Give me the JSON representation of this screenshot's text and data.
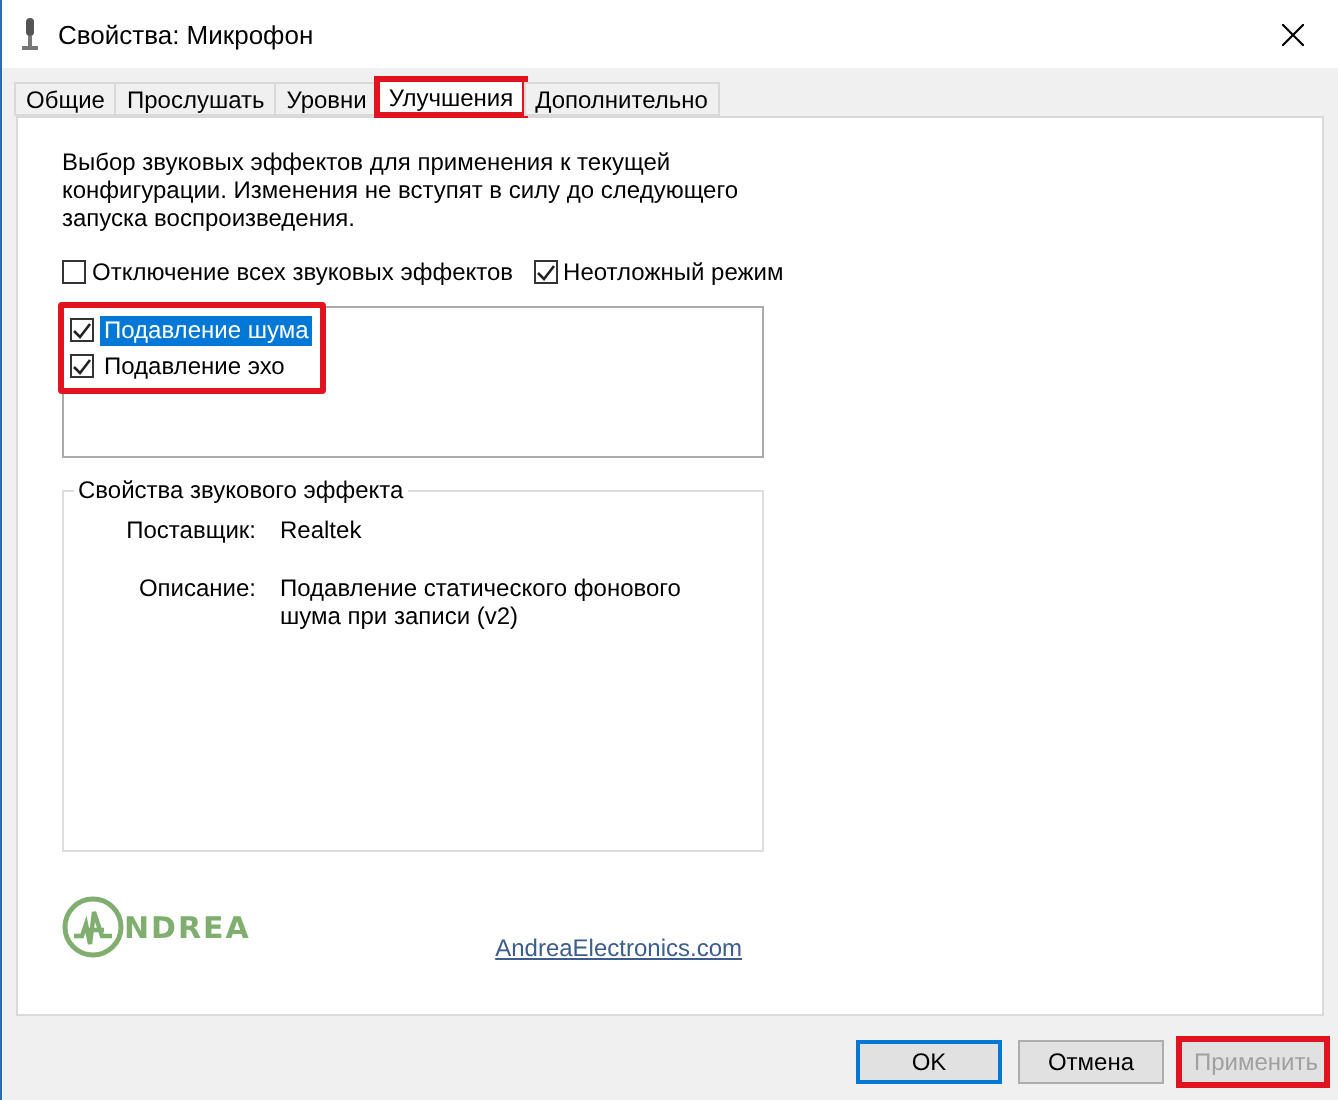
{
  "window": {
    "title": "Свойства: Микрофон"
  },
  "tabs": [
    {
      "label": "Общие",
      "selected": false,
      "highlighted": false
    },
    {
      "label": "Прослушать",
      "selected": false,
      "highlighted": false
    },
    {
      "label": "Уровни",
      "selected": false,
      "highlighted": false
    },
    {
      "label": "Улучшения",
      "selected": true,
      "highlighted": true
    },
    {
      "label": "Дополнительно",
      "selected": false,
      "highlighted": false
    }
  ],
  "description": "Выбор звуковых эффектов для применения к текущей конфигурации. Изменения не вступят в силу до следующего запуска воспроизведения.",
  "options": [
    {
      "label": "Отключение всех звуковых эффектов",
      "checked": false
    },
    {
      "label": "Неотложный режим",
      "checked": true
    }
  ],
  "effects": {
    "highlighted": true,
    "items": [
      {
        "label": "Подавление шума",
        "checked": true,
        "selected": true
      },
      {
        "label": "Подавление эхо",
        "checked": true,
        "selected": false
      }
    ]
  },
  "effect_properties": {
    "title": "Свойства звукового эффекта",
    "rows": [
      {
        "label": "Поставщик:",
        "value": "Realtek"
      },
      {
        "label": "Описание:",
        "value": "Подавление статического фонового шума при записи (v2)"
      }
    ]
  },
  "logo": {
    "text": "NDREA"
  },
  "link": "AndreaElectronics.com",
  "buttons": [
    {
      "label": "OK",
      "kind": "default",
      "disabled": false,
      "highlighted": false
    },
    {
      "label": "Отмена",
      "kind": "normal",
      "disabled": false,
      "highlighted": false
    },
    {
      "label": "Применить",
      "kind": "normal",
      "disabled": true,
      "highlighted": true
    }
  ]
}
